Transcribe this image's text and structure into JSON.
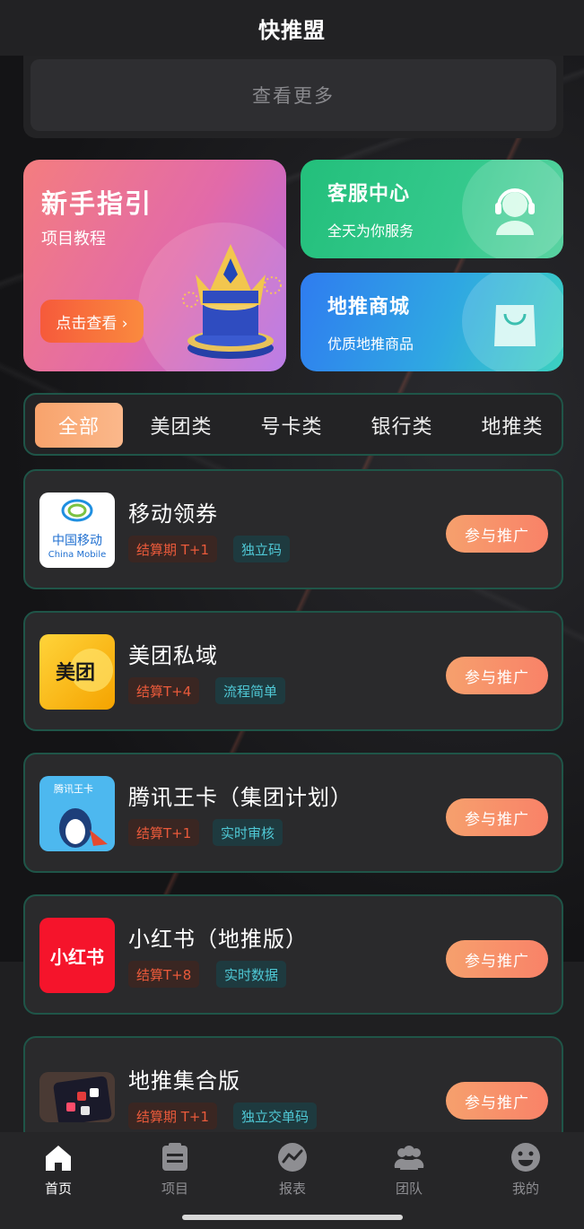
{
  "header": {
    "title": "快推盟"
  },
  "more": {
    "label": "查看更多"
  },
  "banners": {
    "guide": {
      "title": "新手指引",
      "subtitle": "项目教程",
      "button": "点击查看 ›"
    },
    "service": {
      "title": "客服中心",
      "subtitle": "全天为你服务"
    },
    "mall": {
      "title": "地推商城",
      "subtitle": "优质地推商品"
    }
  },
  "tabs": [
    {
      "label": "全部",
      "active": true
    },
    {
      "label": "美团类"
    },
    {
      "label": "号卡类"
    },
    {
      "label": "银行类"
    },
    {
      "label": "地推类"
    }
  ],
  "projects": [
    {
      "name": "移动领券",
      "settle": "结算期 T+1",
      "feature": "独立码",
      "button": "参与推广",
      "logo_text": "中国移动",
      "logo_sub": "China Mobile"
    },
    {
      "name": "美团私域",
      "settle": "结算T+4",
      "feature": "流程简单",
      "button": "参与推广",
      "logo_text": "美团"
    },
    {
      "name": "腾讯王卡（集团计划）",
      "settle": "结算T+1",
      "feature": "实时审核",
      "button": "参与推广",
      "logo_text": "腾讯王卡"
    },
    {
      "name": "小红书（地推版）",
      "settle": "结算T+8",
      "feature": "实时数据",
      "button": "参与推广",
      "logo_text": "小红书"
    },
    {
      "name": "地推集合版",
      "settle": "结算期 T+1",
      "feature": "独立交单码",
      "button": "参与推广"
    }
  ],
  "nav": [
    {
      "label": "首页",
      "icon": "home-icon",
      "active": true
    },
    {
      "label": "项目",
      "icon": "clipboard-icon"
    },
    {
      "label": "报表",
      "icon": "chart-icon"
    },
    {
      "label": "团队",
      "icon": "team-icon"
    },
    {
      "label": "我的",
      "icon": "smile-icon"
    }
  ],
  "colors": {
    "accent": "#f98268",
    "tab_active": "#f8a36c",
    "card_border": "#1f5548",
    "settle_text": "#ea5a3b",
    "feature_text": "#4fc8d5"
  }
}
